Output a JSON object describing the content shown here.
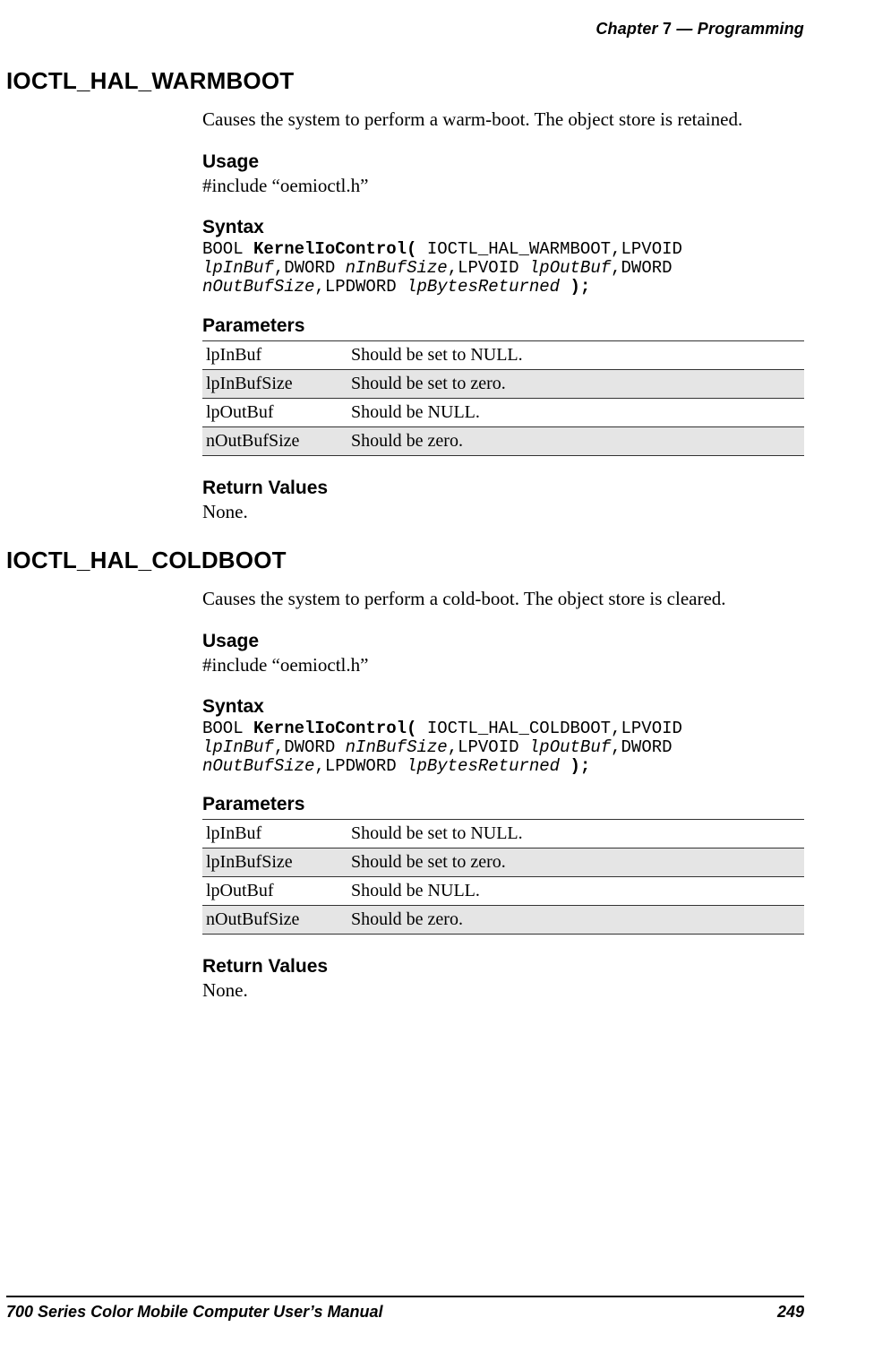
{
  "header": {
    "chapter_word": "Chapter",
    "chapter_number": "7",
    "dash": "—",
    "chapter_title": "Programming"
  },
  "sections": [
    {
      "title": "IOCTL_HAL_WARMBOOT",
      "description": "Causes the system to perform a warm-boot. The object store is retained.",
      "usage_heading": "Usage",
      "usage_text": "#include “oemioctl.h”",
      "syntax_heading": "Syntax",
      "syntax": {
        "l1a": "BOOL ",
        "l1b": "KernelIoControl(",
        "l1c": " IOCTL_HAL_WARMBOOT,LPVOID",
        "l2a": "lpInBuf",
        "l2b": ",DWORD ",
        "l2c": "nInBufSize",
        "l2d": ",LPVOID ",
        "l2e": "lpOutBuf",
        "l2f": ",DWORD",
        "l3a": "nOutBufSize",
        "l3b": ",LPDWORD ",
        "l3c": "lpBytesReturned",
        "l3d": " );"
      },
      "params_heading": "Parameters",
      "params": [
        {
          "name": "lpInBuf",
          "desc": "Should be set to NULL."
        },
        {
          "name": "lpInBufSize",
          "desc": "Should be set to zero."
        },
        {
          "name": "lpOutBuf",
          "desc": "Should be NULL."
        },
        {
          "name": "nOutBufSize",
          "desc": "Should be zero."
        }
      ],
      "return_heading": "Return Values",
      "return_text": "None."
    },
    {
      "title": "IOCTL_HAL_COLDBOOT",
      "description": "Causes the system to perform a cold-boot. The object store is cleared.",
      "usage_heading": "Usage",
      "usage_text": "#include “oemioctl.h”",
      "syntax_heading": "Syntax",
      "syntax": {
        "l1a": "BOOL ",
        "l1b": "KernelIoControl(",
        "l1c": " IOCTL_HAL_COLDBOOT,LPVOID",
        "l2a": "lpInBuf",
        "l2b": ",DWORD ",
        "l2c": "nInBufSize",
        "l2d": ",LPVOID ",
        "l2e": "lpOutBuf",
        "l2f": ",DWORD",
        "l3a": "nOutBufSize",
        "l3b": ",LPDWORD ",
        "l3c": "lpBytesReturned",
        "l3d": " );"
      },
      "params_heading": "Parameters",
      "params": [
        {
          "name": "lpInBuf",
          "desc": "Should be set to NULL."
        },
        {
          "name": "lpInBufSize",
          "desc": "Should be set to zero."
        },
        {
          "name": "lpOutBuf",
          "desc": "Should be NULL."
        },
        {
          "name": "nOutBufSize",
          "desc": "Should be zero."
        }
      ],
      "return_heading": "Return Values",
      "return_text": "None."
    }
  ],
  "footer": {
    "manual_title": "700 Series Color Mobile Computer User’s Manual",
    "page_number": "249"
  }
}
